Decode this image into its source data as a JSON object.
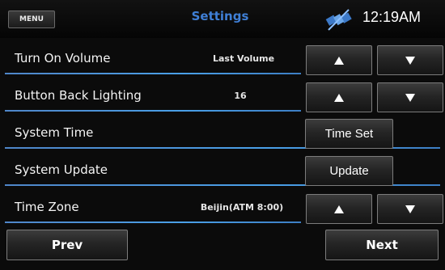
{
  "header": {
    "menu_label": "MENU",
    "title": "Settings",
    "status_icon": "satellite-icon",
    "clock": "12:19AM"
  },
  "rows": [
    {
      "label": "Turn On Volume",
      "value": "Last Volume",
      "controls": "arrows"
    },
    {
      "label": "Button Back Lighting",
      "value": "16",
      "controls": "arrows"
    },
    {
      "label": "System Time",
      "value": "",
      "controls": "button",
      "button_label": "Time Set"
    },
    {
      "label": "System Update",
      "value": "",
      "controls": "button",
      "button_label": "Update"
    },
    {
      "label": "Time Zone",
      "value": "Beijin(ATM 8:00)",
      "controls": "arrows"
    }
  ],
  "footer": {
    "prev_label": "Prev",
    "next_label": "Next"
  },
  "colors": {
    "title": "#3f7fd6",
    "divider": "#4aa0e8",
    "background": "#0b0b0b"
  }
}
